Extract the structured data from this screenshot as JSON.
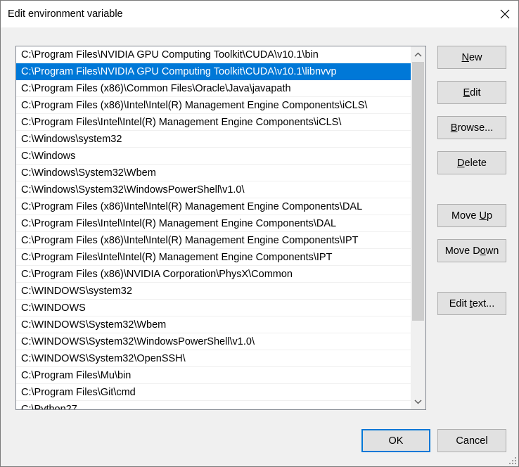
{
  "dialog": {
    "title": "Edit environment variable"
  },
  "path_entries": [
    "C:\\Program Files\\NVIDIA GPU Computing Toolkit\\CUDA\\v10.1\\bin",
    "C:\\Program Files\\NVIDIA GPU Computing Toolkit\\CUDA\\v10.1\\libnvvp",
    "C:\\Program Files (x86)\\Common Files\\Oracle\\Java\\javapath",
    "C:\\Program Files (x86)\\Intel\\Intel(R) Management Engine Components\\iCLS\\",
    "C:\\Program Files\\Intel\\Intel(R) Management Engine Components\\iCLS\\",
    "C:\\Windows\\system32",
    "C:\\Windows",
    "C:\\Windows\\System32\\Wbem",
    "C:\\Windows\\System32\\WindowsPowerShell\\v1.0\\",
    "C:\\Program Files (x86)\\Intel\\Intel(R) Management Engine Components\\DAL",
    "C:\\Program Files\\Intel\\Intel(R) Management Engine Components\\DAL",
    "C:\\Program Files (x86)\\Intel\\Intel(R) Management Engine Components\\IPT",
    "C:\\Program Files\\Intel\\Intel(R) Management Engine Components\\IPT",
    "C:\\Program Files (x86)\\NVIDIA Corporation\\PhysX\\Common",
    "C:\\WINDOWS\\system32",
    "C:\\WINDOWS",
    "C:\\WINDOWS\\System32\\Wbem",
    "C:\\WINDOWS\\System32\\WindowsPowerShell\\v1.0\\",
    "C:\\WINDOWS\\System32\\OpenSSH\\",
    "C:\\Program Files\\Mu\\bin",
    "C:\\Program Files\\Git\\cmd",
    "C:\\Python27"
  ],
  "selected_index": 1,
  "buttons": {
    "new": {
      "pre": "",
      "key": "N",
      "post": "ew"
    },
    "edit": {
      "pre": "",
      "key": "E",
      "post": "dit"
    },
    "browse": {
      "pre": "",
      "key": "B",
      "post": "rowse..."
    },
    "delete": {
      "pre": "",
      "key": "D",
      "post": "elete"
    },
    "move_up": {
      "pre": "Move ",
      "key": "U",
      "post": "p"
    },
    "move_down": {
      "pre": "Move D",
      "key": "o",
      "post": "wn"
    },
    "edit_text": {
      "pre": "Edit ",
      "key": "t",
      "post": "ext..."
    },
    "ok": {
      "label": "OK"
    },
    "cancel": {
      "label": "Cancel"
    }
  },
  "colors": {
    "selection": "#0078d7",
    "button_face": "#e1e1e1",
    "dialog_bg": "#f0f0f0"
  },
  "icons": {
    "close": "close-icon",
    "scroll_up": "chevron-up-icon",
    "scroll_down": "chevron-down-icon",
    "resize": "resize-grip-icon"
  }
}
